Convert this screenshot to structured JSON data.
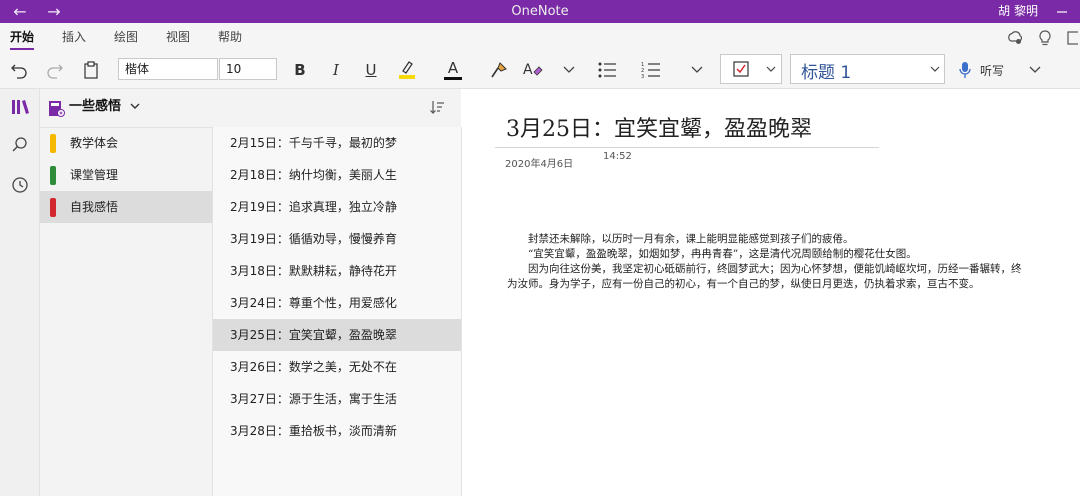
{
  "titlebar": {
    "back_glyph": "←",
    "forward_glyph": "→",
    "app_name": "OneNote",
    "user_name": "胡 黎明"
  },
  "ribbon": {
    "tabs": [
      {
        "label": "开始",
        "active": true
      },
      {
        "label": "插入",
        "active": false
      },
      {
        "label": "绘图",
        "active": false
      },
      {
        "label": "视图",
        "active": false
      },
      {
        "label": "帮助",
        "active": false
      }
    ],
    "font_name": "楷体",
    "font_size": "10",
    "bold": "B",
    "italic": "I",
    "underline": "U",
    "font_color_glyph": "A",
    "paragraph_style": "标题 1",
    "dictate_label": "听写",
    "highlight_color": "#f5d90a",
    "font_color": "#111111"
  },
  "notebook": {
    "name": "一些感悟",
    "sections": [
      {
        "label": "教学体会",
        "color": "#f5b800",
        "selected": false
      },
      {
        "label": "课堂管理",
        "color": "#2e8b3a",
        "selected": false
      },
      {
        "label": "自我感悟",
        "color": "#d3272f",
        "selected": true
      }
    ],
    "pages": [
      {
        "label": "2月15日：千与千寻，最初的梦",
        "selected": false
      },
      {
        "label": "2月18日：纳什均衡，美丽人生",
        "selected": false
      },
      {
        "label": "2月19日：追求真理，独立冷静",
        "selected": false
      },
      {
        "label": "3月19日：循循劝导，慢慢养育",
        "selected": false
      },
      {
        "label": "3月18日：默默耕耘，静待花开",
        "selected": false
      },
      {
        "label": "3月24日：尊重个性，用爱感化",
        "selected": false
      },
      {
        "label": "3月25日：宜笑宜颦，盈盈晚翠",
        "selected": true
      },
      {
        "label": "3月26日：数学之美，无处不在",
        "selected": false
      },
      {
        "label": "3月27日：源于生活，寓于生活",
        "selected": false
      },
      {
        "label": "3月28日：重拾板书，淡而清新",
        "selected": false
      }
    ]
  },
  "note": {
    "title": "3月25日：宜笑宜颦，盈盈晚翠",
    "date": "2020年4月6日",
    "time": "14:52",
    "paragraphs": [
      "封禁还未解除，以历时一月有余，课上能明显能感觉到孩子们的疲倦。",
      "“宜笑宜颦，盈盈晚翠，如烟如梦，冉冉青春”，这是清代况周颐给制的樱花仕女图。",
      "因为向往这份美，我坚定初心砥砺前行，终圆梦武大；因为心怀梦想，便能饥崎岖坎坷，历经一番辗转，终为汝师。身为学子，应有一份自己的初心，有一个自己的梦，纵使日月更迭，仍执着求索，亘古不变。"
    ]
  },
  "theme": {
    "accent": "#7a2aa6"
  }
}
